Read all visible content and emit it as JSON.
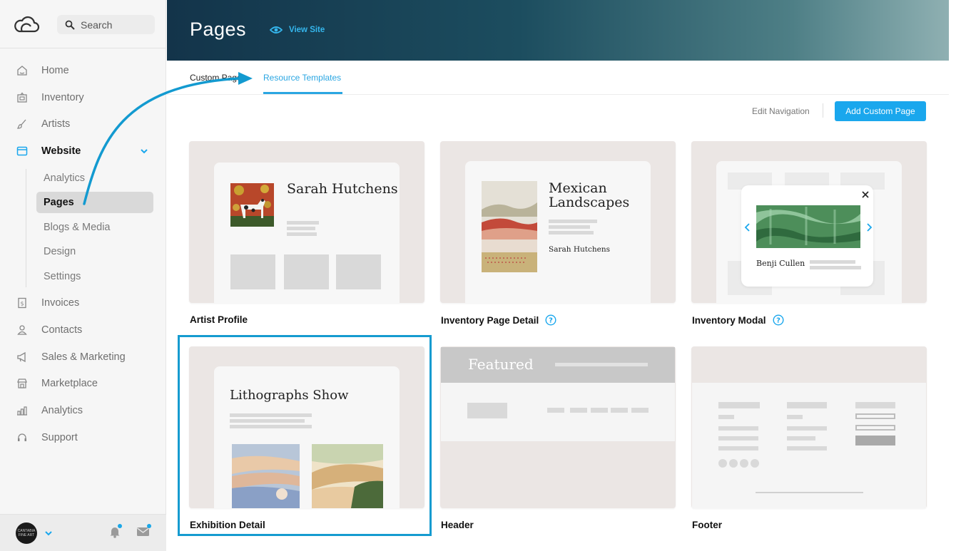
{
  "sidebar": {
    "search_placeholder": "Search",
    "items": [
      {
        "label": "Home",
        "icon": "home-icon"
      },
      {
        "label": "Inventory",
        "icon": "inventory-icon"
      },
      {
        "label": "Artists",
        "icon": "brush-icon"
      },
      {
        "label": "Website",
        "icon": "browser-icon"
      },
      {
        "label": "Invoices",
        "icon": "invoice-icon"
      },
      {
        "label": "Contacts",
        "icon": "person-icon"
      },
      {
        "label": "Sales & Marketing",
        "icon": "megaphone-icon"
      },
      {
        "label": "Marketplace",
        "icon": "store-icon"
      },
      {
        "label": "Analytics",
        "icon": "chart-icon"
      },
      {
        "label": "Support",
        "icon": "support-icon"
      }
    ],
    "website_sub": [
      "Analytics",
      "Pages",
      "Blogs & Media",
      "Design",
      "Settings"
    ],
    "avatar_text": "CANTABIA FINE ART"
  },
  "header": {
    "title": "Pages",
    "view_site": "View Site"
  },
  "tabs": [
    "Custom Pages",
    "Resource Templates"
  ],
  "toolbar": {
    "edit_navigation": "Edit Navigation",
    "add_custom_page": "Add Custom Page"
  },
  "cards": [
    {
      "label": "Artist Profile",
      "thumb_title": "Sarah Hutchens"
    },
    {
      "label": "Inventory Page Detail",
      "thumb_title": "Mexican Landscapes",
      "thumb_sub": "Sarah Hutchens"
    },
    {
      "label": "Inventory Modal",
      "thumb_sub": "Benji Cullen"
    },
    {
      "label": "Exhibition Detail",
      "thumb_title": "Lithographs Show"
    },
    {
      "label": "Header",
      "thumb_title": "Featured"
    },
    {
      "label": "Footer"
    }
  ],
  "colors": {
    "accent": "#1aa7ed",
    "highlight_frame": "#159bd0"
  }
}
